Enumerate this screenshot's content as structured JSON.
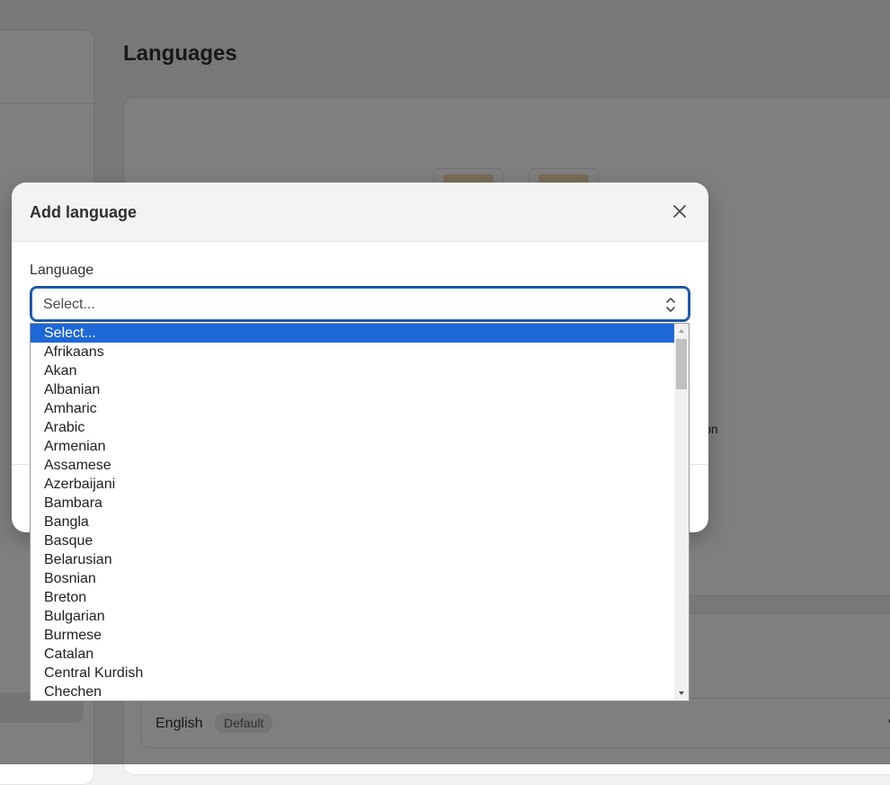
{
  "page": {
    "title": "Languages",
    "partial_text": "sion",
    "default_language": {
      "name": "English",
      "badge": "Default",
      "more_label": "•••"
    }
  },
  "modal": {
    "title": "Add language",
    "field_label": "Language",
    "select_value": "Select...",
    "options": [
      "Select...",
      "Afrikaans",
      "Akan",
      "Albanian",
      "Amharic",
      "Arabic",
      "Armenian",
      "Assamese",
      "Azerbaijani",
      "Bambara",
      "Bangla",
      "Basque",
      "Belarusian",
      "Bosnian",
      "Breton",
      "Bulgarian",
      "Burmese",
      "Catalan",
      "Central Kurdish",
      "Chechen"
    ],
    "selected_index": 0
  },
  "icons": {
    "close": "close-icon",
    "select_arrows": "chevron-up-down-icon",
    "more": "more-horizontal-icon"
  },
  "colors": {
    "selected_option_bg": "#1e67d6",
    "focus_border": "#1a4f9a",
    "badge_bg": "#ebebeb",
    "illustration_fill": "#f3d9b1"
  }
}
